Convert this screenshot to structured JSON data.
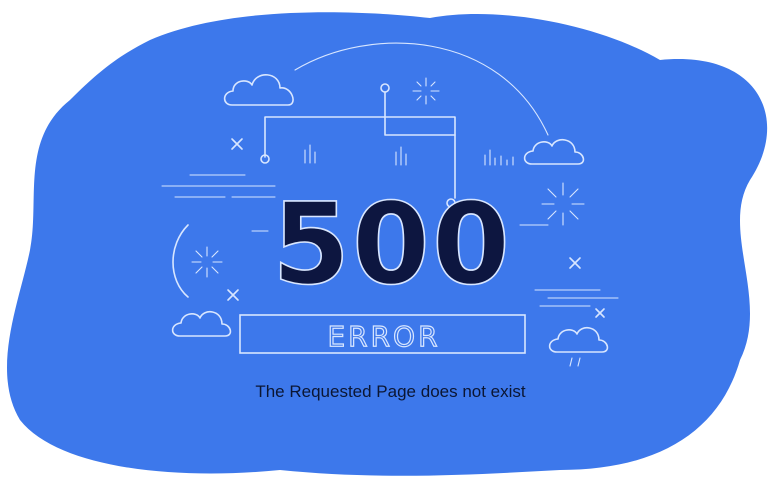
{
  "error": {
    "code": "500",
    "label": "ERROR",
    "message": "The Requested Page does not exist"
  },
  "colors": {
    "blob": "#3d78eb",
    "line_art": "#d8e6ff",
    "code_fill": "#0d1640",
    "message_text": "#0b1633"
  },
  "icons": [
    "cloud-icon",
    "sparkle-icon",
    "cross-icon",
    "bar-chart-icon",
    "circle-node-icon"
  ]
}
